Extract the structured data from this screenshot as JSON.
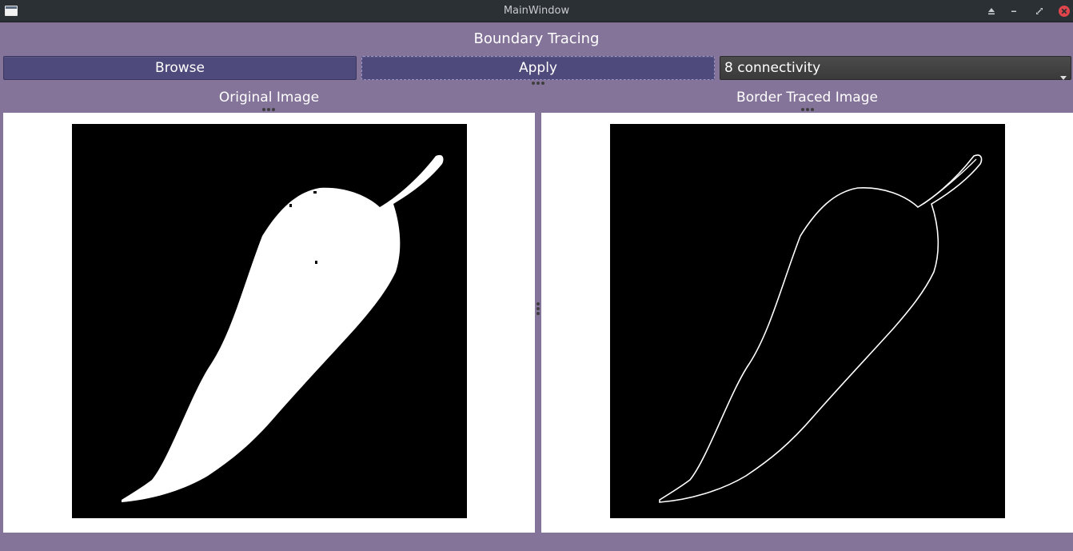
{
  "window": {
    "title": "MainWindow",
    "icons": [
      "window-icon",
      "keep-above-icon",
      "minimize-icon",
      "maximize-icon",
      "close-icon"
    ],
    "close_color": "#e0454b"
  },
  "header": {
    "title": "Boundary Tracing"
  },
  "toolbar": {
    "browse_label": "Browse",
    "apply_label": "Apply",
    "connectivity_selected": "8 connectivity"
  },
  "panels": {
    "left_label": "Original Image",
    "right_label": "Border Traced Image"
  },
  "colors": {
    "background": "#85749a",
    "button": "#4f4a7c",
    "titlebar": "#2b3035"
  }
}
